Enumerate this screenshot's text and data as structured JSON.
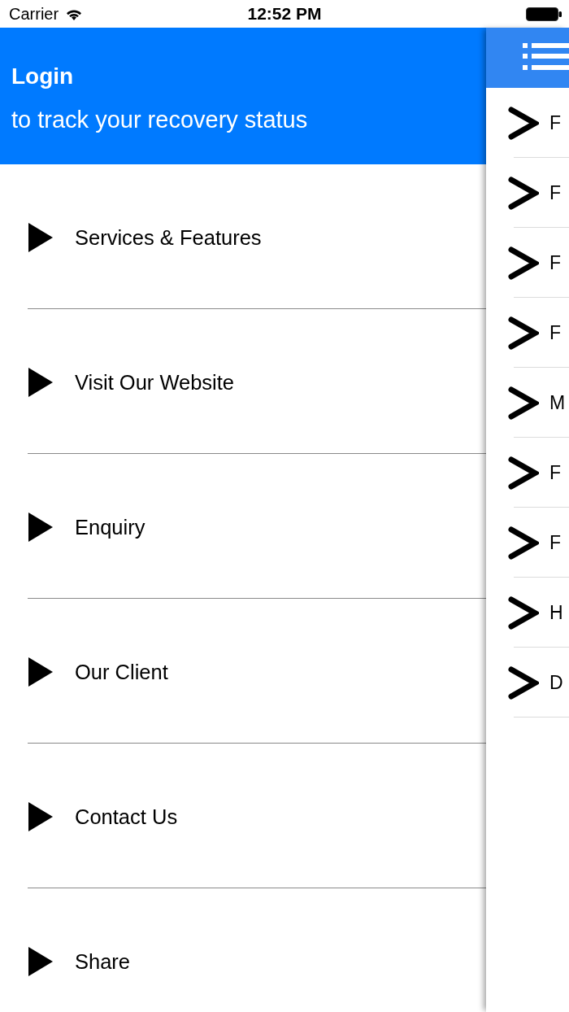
{
  "status_bar": {
    "carrier": "Carrier",
    "time": "12:52 PM"
  },
  "drawer": {
    "header": {
      "title": "Login",
      "subtitle": "to track your recovery status"
    },
    "menu_items": [
      {
        "label": "Services & Features"
      },
      {
        "label": "Visit Our Website"
      },
      {
        "label": "Enquiry"
      },
      {
        "label": "Our Client"
      },
      {
        "label": "Contact Us"
      },
      {
        "label": "Share"
      }
    ]
  },
  "main_panel": {
    "rows": [
      {
        "label": "F"
      },
      {
        "label": "F"
      },
      {
        "label": "F"
      },
      {
        "label": "F"
      },
      {
        "label": "M"
      },
      {
        "label": "F"
      },
      {
        "label": "F"
      },
      {
        "label": "H"
      },
      {
        "label": "D"
      }
    ]
  }
}
